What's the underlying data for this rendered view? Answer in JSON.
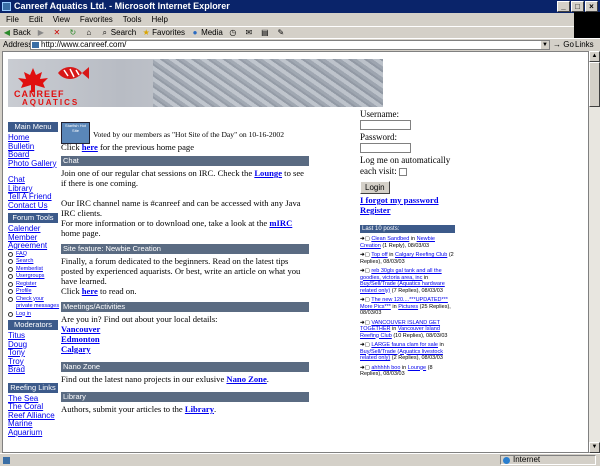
{
  "window": {
    "title": "Canreef Aquatics Ltd. - Microsoft Internet Explorer"
  },
  "menu": [
    "File",
    "Edit",
    "View",
    "Favorites",
    "Tools",
    "Help"
  ],
  "toolbar": {
    "back": "Back",
    "search": "Search",
    "favorites": "Favorites",
    "media": "Media"
  },
  "address": {
    "label": "Address",
    "url": "http://www.canreef.com/",
    "go": "Go",
    "links": "Links"
  },
  "status": {
    "zone": "Internet"
  },
  "logo": {
    "brand_top": "CANREEF",
    "brand_bottom": "AQUATICS"
  },
  "left": {
    "main_menu_title": "Main Menu",
    "main_menu": [
      "Home",
      "Bulletin",
      "Board",
      "Photo Gallery"
    ],
    "main_menu2": [
      "Chat",
      "Library",
      "Tell A Friend",
      "Contact Us"
    ],
    "forum_tools_title": "Forum Tools",
    "forum_tools": [
      "Calender",
      "Member",
      "Agreement"
    ],
    "forum_small": [
      "FAQ",
      "Search",
      "Memberlist",
      "Usergroups",
      "Register",
      "Profile",
      "Check your",
      "private messages",
      "Log in"
    ],
    "moderators_title": "Moderators",
    "moderators": [
      "Titus",
      "Doug",
      "Tony",
      "Troy",
      "Brad"
    ],
    "reefing_title": "Reefing Links",
    "reefing": [
      "The Sea",
      "The Coral",
      "Reef Alliance",
      "Marine",
      "Aquarium"
    ]
  },
  "center": {
    "hot_site_badge": "Starfish Hot Site",
    "hot_site_text": "Voted by our members as \"Hot Site of the Day\" on 10-16-2002",
    "prev_text_a": "Click ",
    "prev_link": "here",
    "prev_text_b": " for the previous home page",
    "chat_head": "Chat",
    "chat_p1a": "Join one of our regular chat sessions on IRC. Check the ",
    "chat_p1_link": "Lounge",
    "chat_p1b": " to see if there is one coming.",
    "chat_p2": "Our IRC channel name is #canreef and can be accessed with any Java IRC clients.",
    "chat_p3a": "For more information or to download one, take a look at the ",
    "chat_p3_link": "mIRC",
    "chat_p3b": " home page.",
    "newbie_head": "Site feature: Newbie Creation",
    "newbie_p": "Finally, a forum dedicated to the beginners. Read on the latest tips posted by experienced aquarists. Or best, write an article on what you have learned.",
    "newbie_click_a": "Click ",
    "newbie_link": "here",
    "newbie_click_b": " to read on.",
    "meet_head": "Meetings/Activities",
    "meet_p": "Are you in? Find out about your local details:",
    "meet_cities": [
      "Vancouver",
      "Edmonton",
      "Calgary"
    ],
    "nano_head": "Nano Zone",
    "nano_pa": "Find out the latest nano projects in our exlusive ",
    "nano_link": "Nano Zone",
    "nano_pb": ".",
    "lib_head": "Library",
    "lib_pa": "Authors, submit your articles to the ",
    "lib_link": "Library",
    "lib_pb": "."
  },
  "right": {
    "username_label": "Username:",
    "password_label": "Password:",
    "remember_label": "Log me on automatically each visit:",
    "login_button": "Login",
    "forgot_link": "I forgot my password",
    "register_link": "Register",
    "last_posts_title": "Last 10 posts:",
    "posts": [
      {
        "title": "Clean Sandbed",
        "in": " in ",
        "forum": "Newbie Creation",
        "meta": " (1 Reply)",
        "date": ", 08/03/03"
      },
      {
        "title": "Top off",
        "in": " in ",
        "forum": "Calgary Reefing Club",
        "meta": " (2 Replies)",
        "date": ", 08/03/03"
      },
      {
        "title": "reb 30gls gal tank and all the goodies, victoria area, inc",
        "in": " in ",
        "forum": "Buy/Sell/Trade (Aquatics hardware related only)",
        "meta": " (7 Replies)",
        "date": ", 08/03/03"
      },
      {
        "title": "The new 120....***UPDATED*** More Pics***",
        "in": " in ",
        "forum": "Pictures",
        "meta": " (25 Replies)",
        "date": ", 08/03/03"
      },
      {
        "title": "VANCOUVER ISLAND GET TOGETHER",
        "in": " in ",
        "forum": "Vancouver Island Reefing Club",
        "meta": " (10 Replies)",
        "date": ", 08/03/03"
      },
      {
        "title": "LARGE fauna clam for sale",
        "in": " in ",
        "forum": "Buy/Sell/Trade (Aquatics livestock related only)",
        "meta": " (2 Replies)",
        "date": ", 08/03/03"
      },
      {
        "title": "ahhhhh boo",
        "in": " in ",
        "forum": "Lounge",
        "meta": " (8 Replies)",
        "date": ", 08/03/03"
      }
    ]
  }
}
